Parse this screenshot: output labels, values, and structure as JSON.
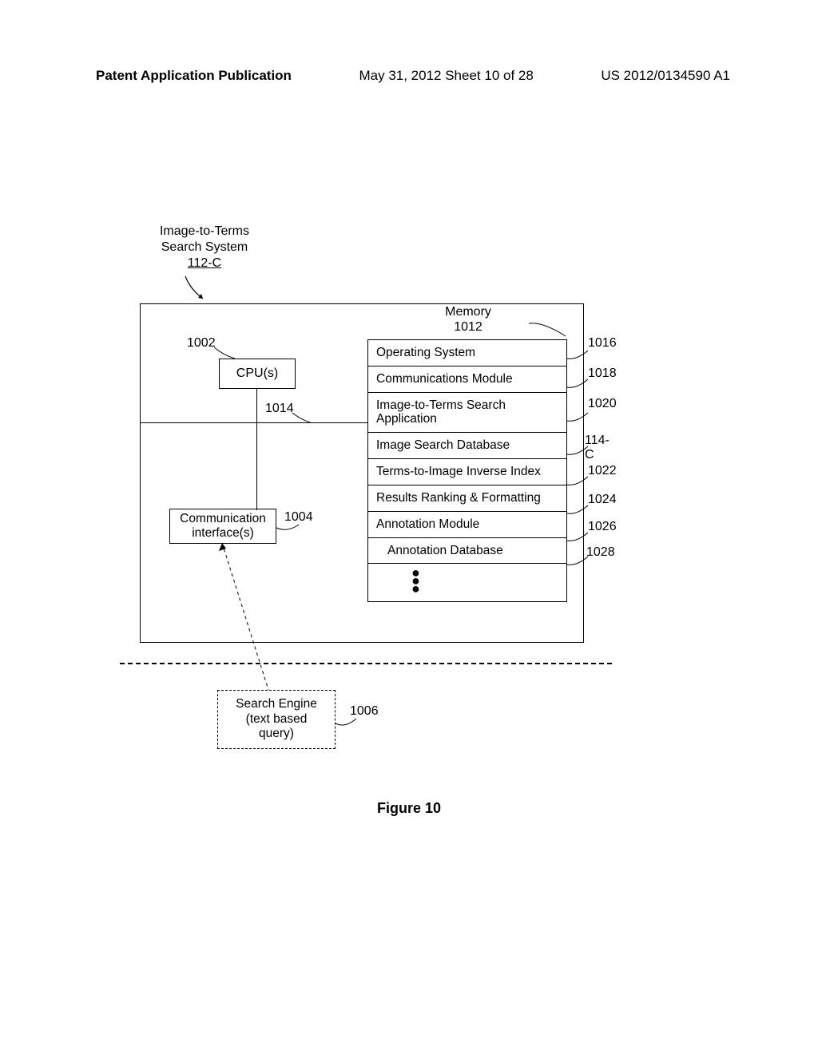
{
  "header": {
    "left": "Patent Application Publication",
    "center": "May 31, 2012  Sheet 10 of 28",
    "right": "US 2012/0134590 A1"
  },
  "system_title": {
    "line1": "Image-to-Terms",
    "line2": "Search System",
    "line3": "112-C"
  },
  "cpu": {
    "label": "CPU(s)",
    "ref": "1002"
  },
  "bus": {
    "ref": "1014"
  },
  "memory": {
    "title_line1": "Memory",
    "title_line2": "1012",
    "rows": [
      {
        "label": "Operating System",
        "ref": "1016"
      },
      {
        "label": "Communications Module",
        "ref": "1018"
      },
      {
        "label": "Image-to-Terms Search Application",
        "ref": "1020"
      },
      {
        "label": "Image Search Database",
        "ref": "114-C"
      },
      {
        "label": "Terms-to-Image Inverse Index",
        "ref": "1022"
      },
      {
        "label": "Results Ranking & Formatting",
        "ref": "1024"
      },
      {
        "label": "Annotation Module",
        "ref": "1026"
      },
      {
        "label": "Annotation Database",
        "ref": "1028",
        "indent": true
      }
    ]
  },
  "comm": {
    "line1": "Communication",
    "line2": "interface(s)",
    "ref": "1004"
  },
  "search_engine": {
    "line1": "Search Engine",
    "line2": "(text based",
    "line3": "query)",
    "ref": "1006"
  },
  "caption": "Figure 10"
}
